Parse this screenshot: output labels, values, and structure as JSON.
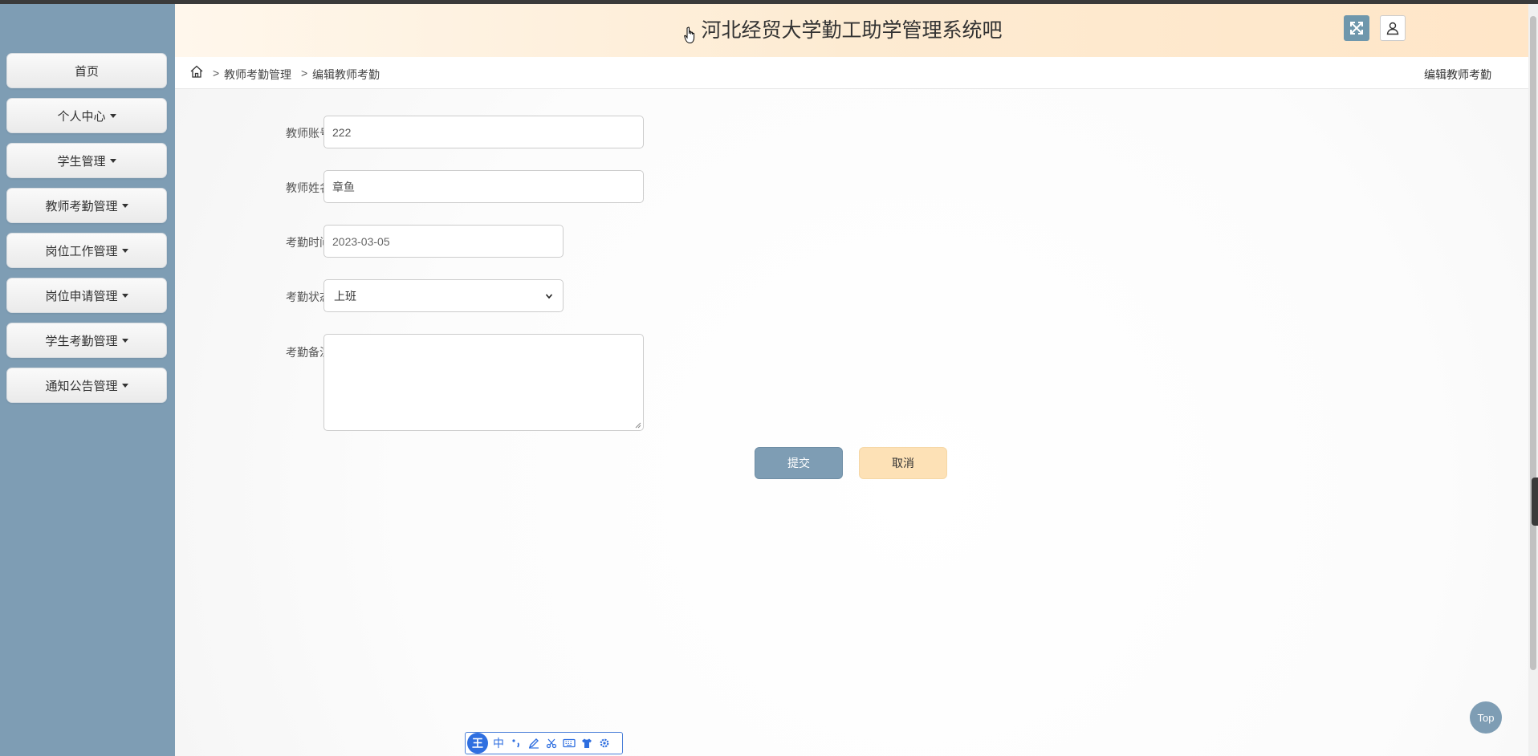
{
  "app": {
    "title": "河北经贸大学勤工助学管理系统吧"
  },
  "sidebar": {
    "items": [
      {
        "label": "首页",
        "has_caret": false
      },
      {
        "label": "个人中心",
        "has_caret": true
      },
      {
        "label": "学生管理",
        "has_caret": true
      },
      {
        "label": "教师考勤管理",
        "has_caret": true
      },
      {
        "label": "岗位工作管理",
        "has_caret": true
      },
      {
        "label": "岗位申请管理",
        "has_caret": true
      },
      {
        "label": "学生考勤管理",
        "has_caret": true
      },
      {
        "label": "通知公告管理",
        "has_caret": true
      }
    ]
  },
  "breadcrumb": {
    "separator": ">",
    "level1": "教师考勤管理",
    "level2": "编辑教师考勤",
    "right_title": "编辑教师考勤"
  },
  "form": {
    "account": {
      "label": "教师账号",
      "value": "222"
    },
    "name": {
      "label": "教师姓名",
      "value": "章鱼"
    },
    "time": {
      "label": "考勤时间",
      "value": "2023-03-05"
    },
    "status": {
      "label": "考勤状态",
      "value": "上班"
    },
    "remark": {
      "label": "考勤备注",
      "value": ""
    },
    "submit_label": "提交",
    "cancel_label": "取消"
  },
  "top_button": {
    "label": "Top"
  },
  "ime": {
    "logo": "王",
    "mode": "中"
  },
  "colors": {
    "sidebar_bg": "#7e9db4",
    "header_bg": "#fdebd2",
    "submit_bg": "#7e9db4",
    "cancel_bg": "#fde1b6"
  },
  "icons": {
    "header_left": "fullscreen-icon",
    "header_right": "user-icon",
    "breadcrumb": "home-icon"
  }
}
